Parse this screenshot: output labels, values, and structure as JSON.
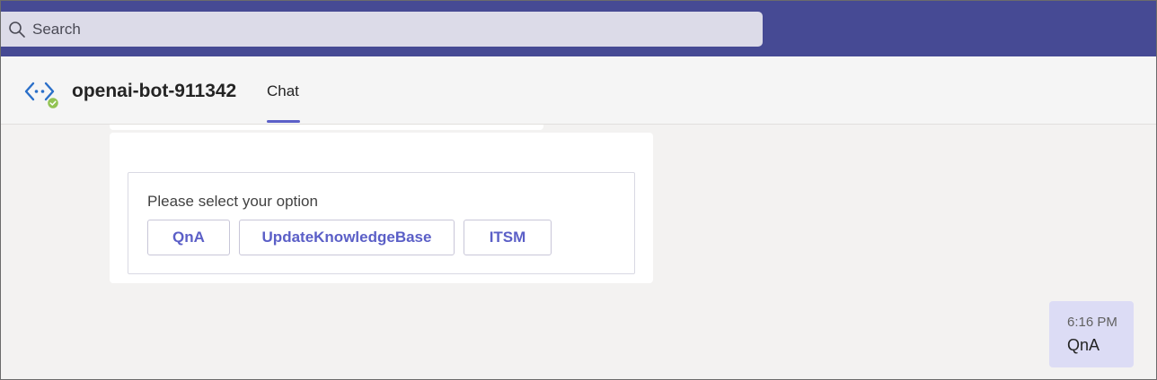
{
  "search": {
    "placeholder": "Search",
    "icon": "search-icon"
  },
  "header": {
    "bot_name": "openai-bot-911342",
    "avatar_icon": "bot-avatar-icon",
    "status_icon": "available-status-icon",
    "tabs": [
      {
        "label": "Chat",
        "active": true
      }
    ]
  },
  "card": {
    "prompt": "Please select your option",
    "options": [
      {
        "label": "QnA"
      },
      {
        "label": "UpdateKnowledgeBase"
      },
      {
        "label": "ITSM"
      }
    ]
  },
  "user_message": {
    "time": "6:16 PM",
    "text": "QnA"
  },
  "colors": {
    "topbar": "#464a94",
    "accent": "#5b5fc7",
    "bubble": "#dcdcf5",
    "status": "#92c353"
  }
}
